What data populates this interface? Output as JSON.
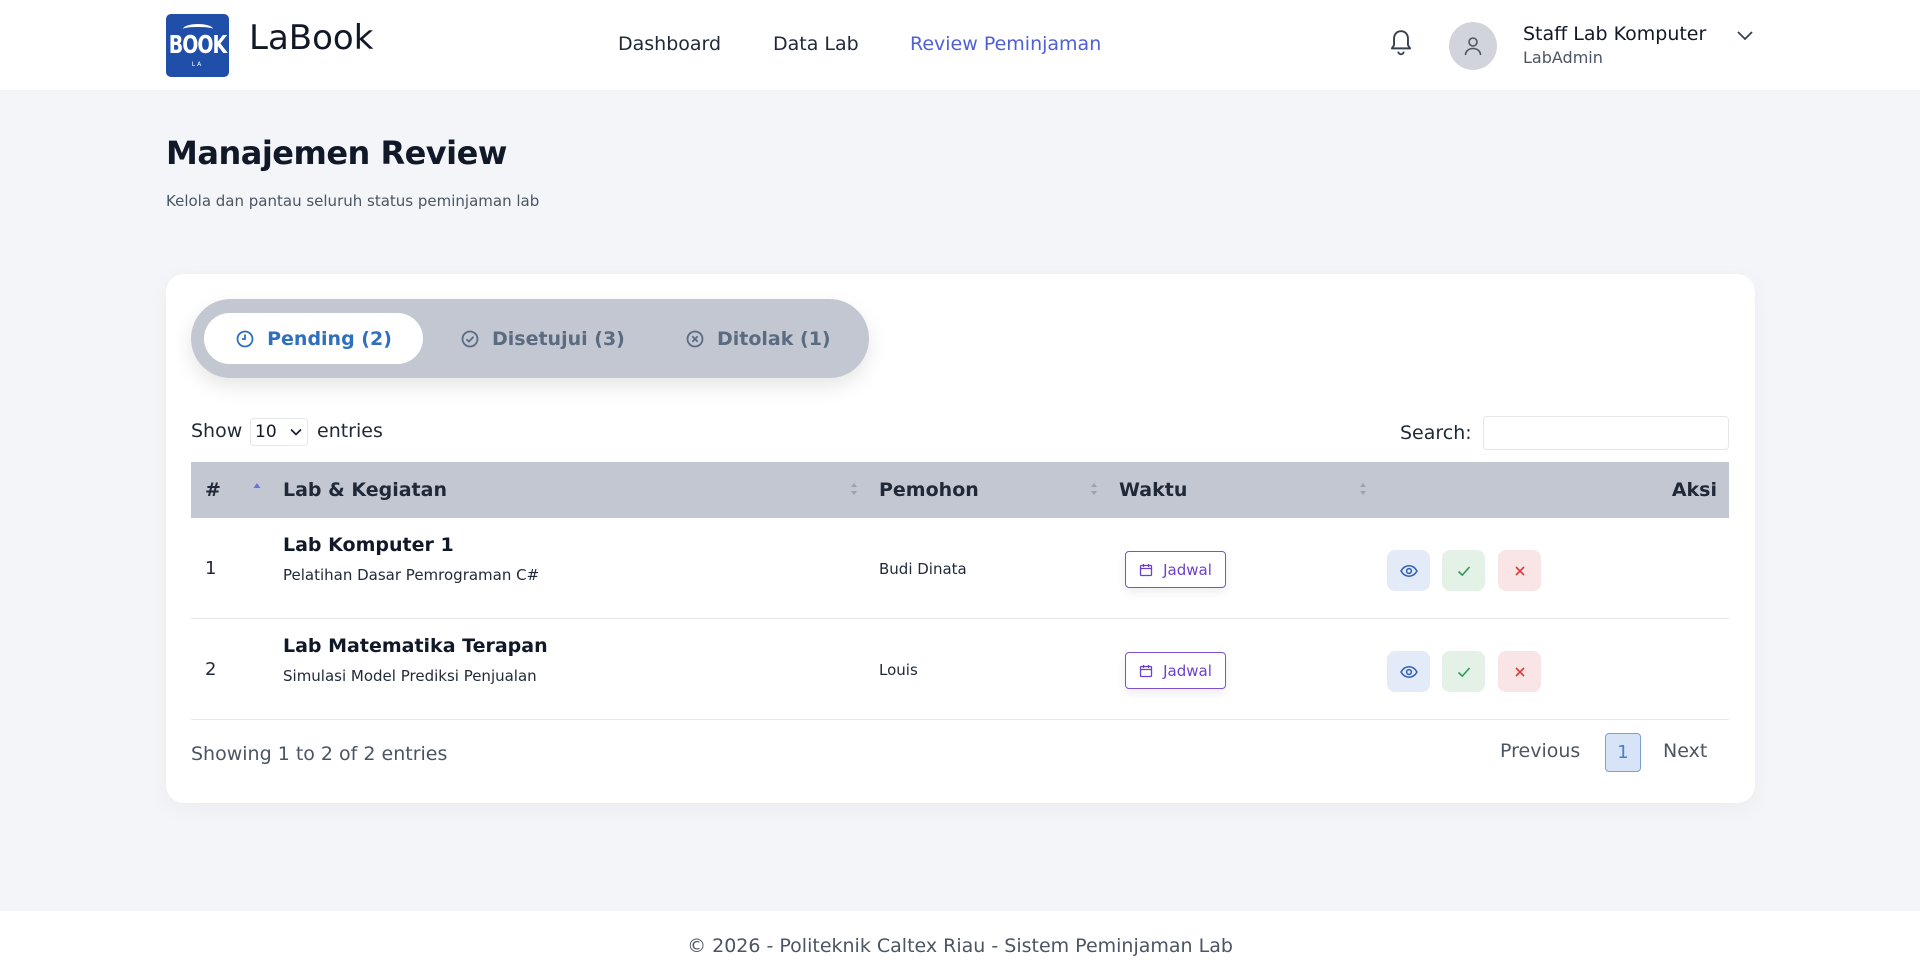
{
  "header": {
    "logo_text": "BOOK",
    "logo_small": "LA",
    "brand": "LaBook",
    "nav": [
      "Dashboard",
      "Data Lab",
      "Review Peminjaman"
    ],
    "active_nav": "Review Peminjaman",
    "user_name": "Staff Lab Komputer",
    "user_role": "LabAdmin"
  },
  "page": {
    "title": "Manajemen Review",
    "subtitle": "Kelola dan pantau seluruh status peminjaman lab"
  },
  "tabs": [
    {
      "label": "Pending (2)",
      "icon": "clock-icon",
      "active": true
    },
    {
      "label": "Disetujui (3)",
      "icon": "check-circle-icon",
      "active": false
    },
    {
      "label": "Ditolak (1)",
      "icon": "x-circle-icon",
      "active": false
    }
  ],
  "table_controls": {
    "show_label": "Show",
    "show_value": "10",
    "entries_label": "entries",
    "search_label": "Search:",
    "search_value": ""
  },
  "table": {
    "columns": [
      "#",
      "Lab & Kegiatan",
      "Pemohon",
      "Waktu",
      "Aksi"
    ],
    "rows": [
      {
        "num": "1",
        "lab": "Lab Komputer 1",
        "kegiatan": "Pelatihan Dasar Pemrograman C#",
        "pemohon": "Budi Dinata",
        "waktu": "Jadwal"
      },
      {
        "num": "2",
        "lab": "Lab Matematika Terapan",
        "kegiatan": "Simulasi Model Prediksi Penjualan",
        "pemohon": "Louis",
        "waktu": "Jadwal"
      }
    ]
  },
  "pagination": {
    "info": "Showing 1 to 2 of 2 entries",
    "previous": "Previous",
    "current": "1",
    "next": "Next"
  },
  "footer": {
    "text": "© 2026 - Politeknik Caltex Riau - Sistem Peminjaman Lab"
  },
  "colors": {
    "accent": "#4f5fd6",
    "tab_active": "#2f6fbf",
    "logo_bg": "#1f4fa8",
    "jadwal": "#6d3fd0"
  }
}
